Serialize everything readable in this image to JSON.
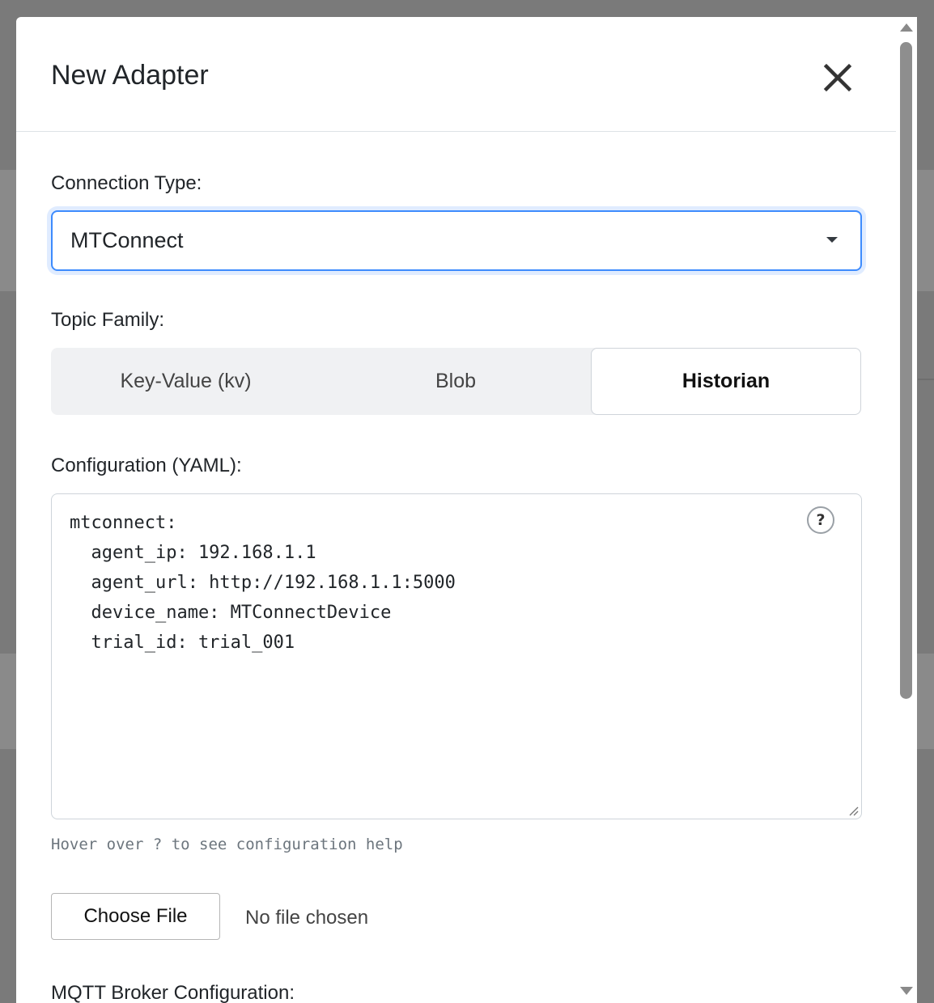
{
  "modal": {
    "title": "New Adapter",
    "close_icon": "close-icon"
  },
  "connection": {
    "label": "Connection Type:",
    "selected": "MTConnect"
  },
  "topic_family": {
    "label": "Topic Family:",
    "options": [
      "Key-Value (kv)",
      "Blob",
      "Historian"
    ],
    "selected": "Historian"
  },
  "configuration": {
    "label": "Configuration (YAML):",
    "content": "mtconnect:\n  agent_ip: 192.168.1.1\n  agent_url: http://192.168.1.1:5000\n  device_name: MTConnectDevice\n  trial_id: trial_001",
    "help_symbol": "?",
    "hint": "Hover over ? to see configuration help"
  },
  "file_upload": {
    "button_label": "Choose File",
    "status": "No file chosen"
  },
  "mqtt": {
    "label": "MQTT Broker Configuration:"
  },
  "colors": {
    "focus_border": "#3d8bfd",
    "overlay": "#7a7a7a",
    "segment_bg": "#f0f1f3"
  }
}
